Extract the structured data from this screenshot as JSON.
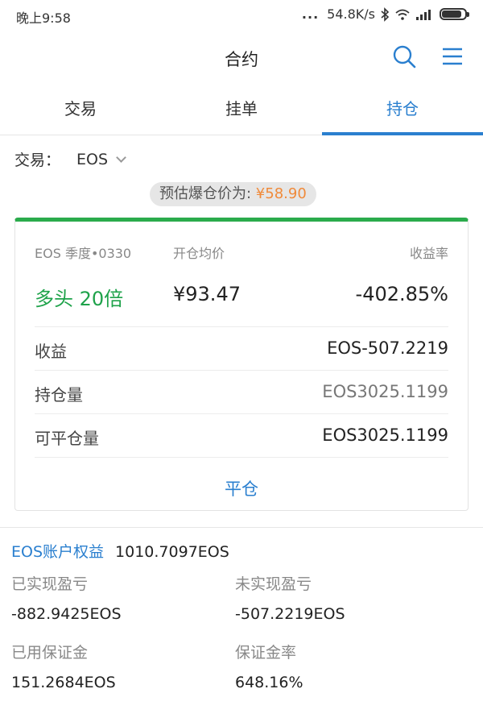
{
  "status": {
    "time": "晚上9:58",
    "dots": "...",
    "speed": "54.8K/s",
    "icons": [
      "bluetooth-icon",
      "wifi-icon",
      "signal-icon",
      "battery-icon"
    ],
    "battery_level": 0.85
  },
  "nav": {
    "title": "合约",
    "search_icon": "search-icon",
    "menu_icon": "menu-icon"
  },
  "tabs": [
    {
      "label": "交易",
      "active": false
    },
    {
      "label": "挂单",
      "active": false
    },
    {
      "label": "持仓",
      "active": true
    }
  ],
  "trade": {
    "label": "交易：",
    "value": "EOS"
  },
  "liquidation": {
    "label": "预估爆仓价为: ",
    "price": "¥58.90"
  },
  "position": {
    "contract": "EOS 季度•0330",
    "avg_price_label": "开仓均价",
    "yield_label": "收益率",
    "side": "多头 20倍",
    "avg_price": "¥93.47",
    "yield": "-402.85%",
    "rows": [
      {
        "label": "收益",
        "value": "EOS-507.2219"
      },
      {
        "label": "持仓量",
        "value": "EOS3025.1199"
      },
      {
        "label": "可平仓量",
        "value": "EOS3025.1199"
      }
    ],
    "close_label": "平仓"
  },
  "account": {
    "title": "EOS账户权益",
    "equity": "1010.7097EOS",
    "realized_label": "已实现盈亏",
    "realized_value": "-882.9425EOS",
    "unrealized_label": "未实现盈亏",
    "unrealized_value": "-507.2219EOS",
    "margin_label": "已用保证金",
    "margin_value": "151.2684EOS",
    "margin_rate_label": "保证金率",
    "margin_rate_value": "648.16%"
  },
  "colors": {
    "accent": "#2a7fcf",
    "long_green": "#1ea24a",
    "liq_orange": "#f08a3a"
  }
}
